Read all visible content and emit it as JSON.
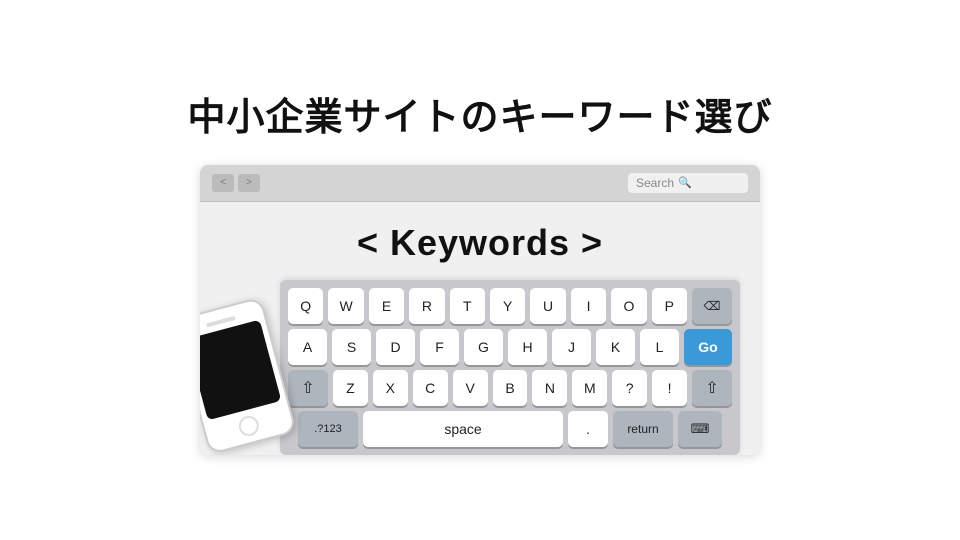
{
  "title": "中小企業サイトのキーワード選び",
  "browser": {
    "nav_button_text": "< >",
    "search_placeholder": "Search",
    "search_icon": "🔍"
  },
  "content": {
    "keywords_label": "< Keywords >",
    "keyboard": {
      "row1": [
        "Q",
        "W",
        "E",
        "R",
        "T",
        "Y",
        "U",
        "I",
        "O",
        "P"
      ],
      "row2": [
        "A",
        "S",
        "D",
        "F",
        "G",
        "H",
        "J",
        "K",
        "L"
      ],
      "row3": [
        "Z",
        "X",
        "C",
        "V",
        "B",
        "N",
        "M"
      ],
      "go_button": "Go",
      "num_button": ".?123",
      "space_label": "space",
      "delete_symbol": "⌫",
      "shift_symbol": "⇧",
      "period_key": ".",
      "question_key": "?",
      "exclaim_key": "!",
      "comma_key": ",",
      "kb_symbol": "⌨"
    }
  }
}
